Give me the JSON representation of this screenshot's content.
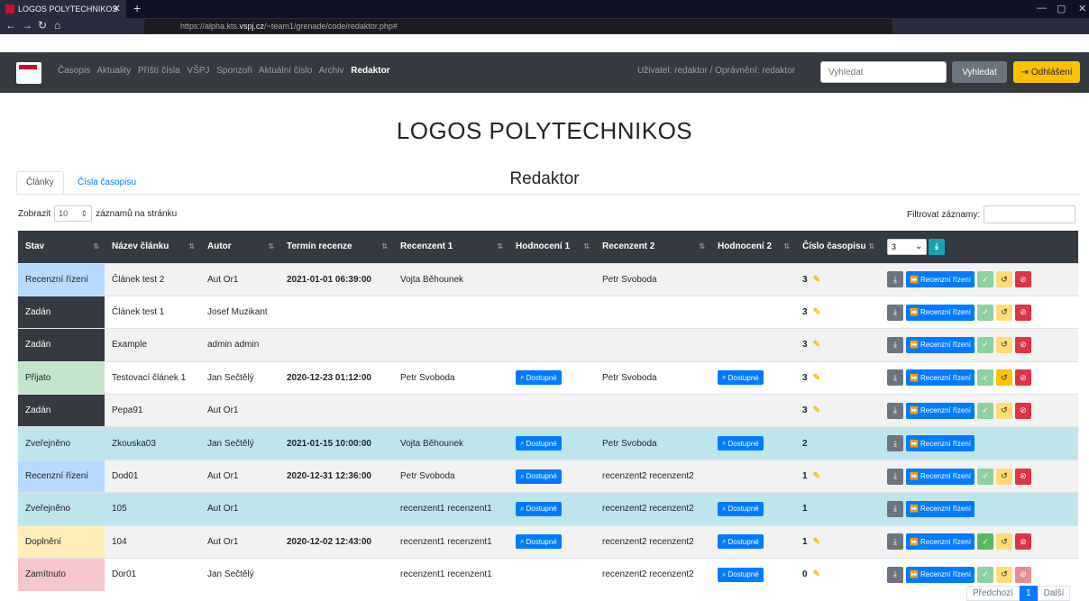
{
  "browser": {
    "tab_title": "LOGOS POLYTECHNIKOS",
    "url_prefix": "https://alpha.kts.",
    "url_domain": "vspj.cz",
    "url_path": "/~team1/grenade/code/redaktor.php#"
  },
  "nav": {
    "items": [
      "Časopis",
      "Aktuality",
      "Příští čísla",
      "VŠPJ",
      "Sponzoři",
      "Aktuální číslo",
      "Archiv"
    ],
    "active": "Redaktor",
    "user_info": "Uživatel: redaktor / Oprávnění: redaktor",
    "search_placeholder": "Vyhledat",
    "search_button": "Vyhledat",
    "logout_button": "Odhlášení"
  },
  "site_title": "LOGOS POLYTECHNIKOS",
  "page_title": "Redaktor",
  "tabs": {
    "articles": "Články",
    "issues": "Čísla časopisu"
  },
  "controls": {
    "show_label": "Zobrazit",
    "page_length": "10",
    "per_page_label": "záznamů na stránku",
    "filter_label": "Filtrovat záznamy:"
  },
  "table": {
    "headers": [
      "Stav",
      "Název článku",
      "Autor",
      "Termín recenze",
      "Recenzent 1",
      "Hodnocení 1",
      "Recenzent 2",
      "Hodnocení 2",
      "Číslo časopisu"
    ],
    "issue_select": "3",
    "available_label": "Dostupné",
    "review_label": "Recenzní řízení",
    "rows": [
      {
        "stav": "Recenzní řízení",
        "nazev": "Článek test 2",
        "autor": "Aut Or1",
        "termin": "2021-01-01 06:39:00",
        "rec1": "Vojta Běhounek",
        "h1": false,
        "rec2": "Petr Svoboda",
        "h2": false,
        "cislo": "3"
      },
      {
        "stav": "Zadán",
        "nazev": "Článek test 1",
        "autor": "Josef Muzikant",
        "termin": "",
        "rec1": "",
        "h1": false,
        "rec2": "",
        "h2": false,
        "cislo": "3"
      },
      {
        "stav": "Zadán",
        "nazev": "Example",
        "autor": "admin admin",
        "termin": "",
        "rec1": "",
        "h1": false,
        "rec2": "",
        "h2": false,
        "cislo": "3"
      },
      {
        "stav": "Přijato",
        "nazev": "Testovací článek 1",
        "autor": "Jan Sečtělý",
        "termin": "2020-12-23 01:12:00",
        "rec1": "Petr Svoboda",
        "h1": true,
        "rec2": "Petr Svoboda",
        "h2": true,
        "cislo": "3"
      },
      {
        "stav": "Zadán",
        "nazev": "Pepa91",
        "autor": "Aut Or1",
        "termin": "",
        "rec1": "",
        "h1": false,
        "rec2": "",
        "h2": false,
        "cislo": "3"
      },
      {
        "stav": "Zveřejněno",
        "nazev": "Zkouska03",
        "autor": "Jan Sečtělý",
        "termin": "2021-01-15 10:00:00",
        "rec1": "Vojta Běhounek",
        "h1": true,
        "rec2": "Petr Svoboda",
        "h2": true,
        "cislo": "2"
      },
      {
        "stav": "Recenzní řízení",
        "nazev": "Dod01",
        "autor": "Aut Or1",
        "termin": "2020-12-31 12:36:00",
        "rec1": "Petr Svoboda",
        "h1": true,
        "rec2": "recenzent2 recenzent2",
        "h2": false,
        "cislo": "1"
      },
      {
        "stav": "Zveřejněno",
        "nazev": "105",
        "autor": "Aut Or1",
        "termin": "",
        "rec1": "recenzent1 recenzent1",
        "h1": true,
        "rec2": "recenzent2 recenzent2",
        "h2": true,
        "cislo": "1"
      },
      {
        "stav": "Doplnění",
        "nazev": "104",
        "autor": "Aut Or1",
        "termin": "2020-12-02 12:43:00",
        "rec1": "recenzent1 recenzent1",
        "h1": true,
        "rec2": "recenzent2 recenzent2",
        "h2": true,
        "cislo": "1"
      },
      {
        "stav": "Zamítnuto",
        "nazev": "Dor01",
        "autor": "Jan Sečtělý",
        "termin": "",
        "rec1": "recenzent1 recenzent1",
        "h1": false,
        "rec2": "recenzent2 recenzent2",
        "h2": true,
        "cislo": "0"
      }
    ]
  },
  "footer": {
    "prev": "Předchozí",
    "page": "1",
    "next": "Další"
  }
}
